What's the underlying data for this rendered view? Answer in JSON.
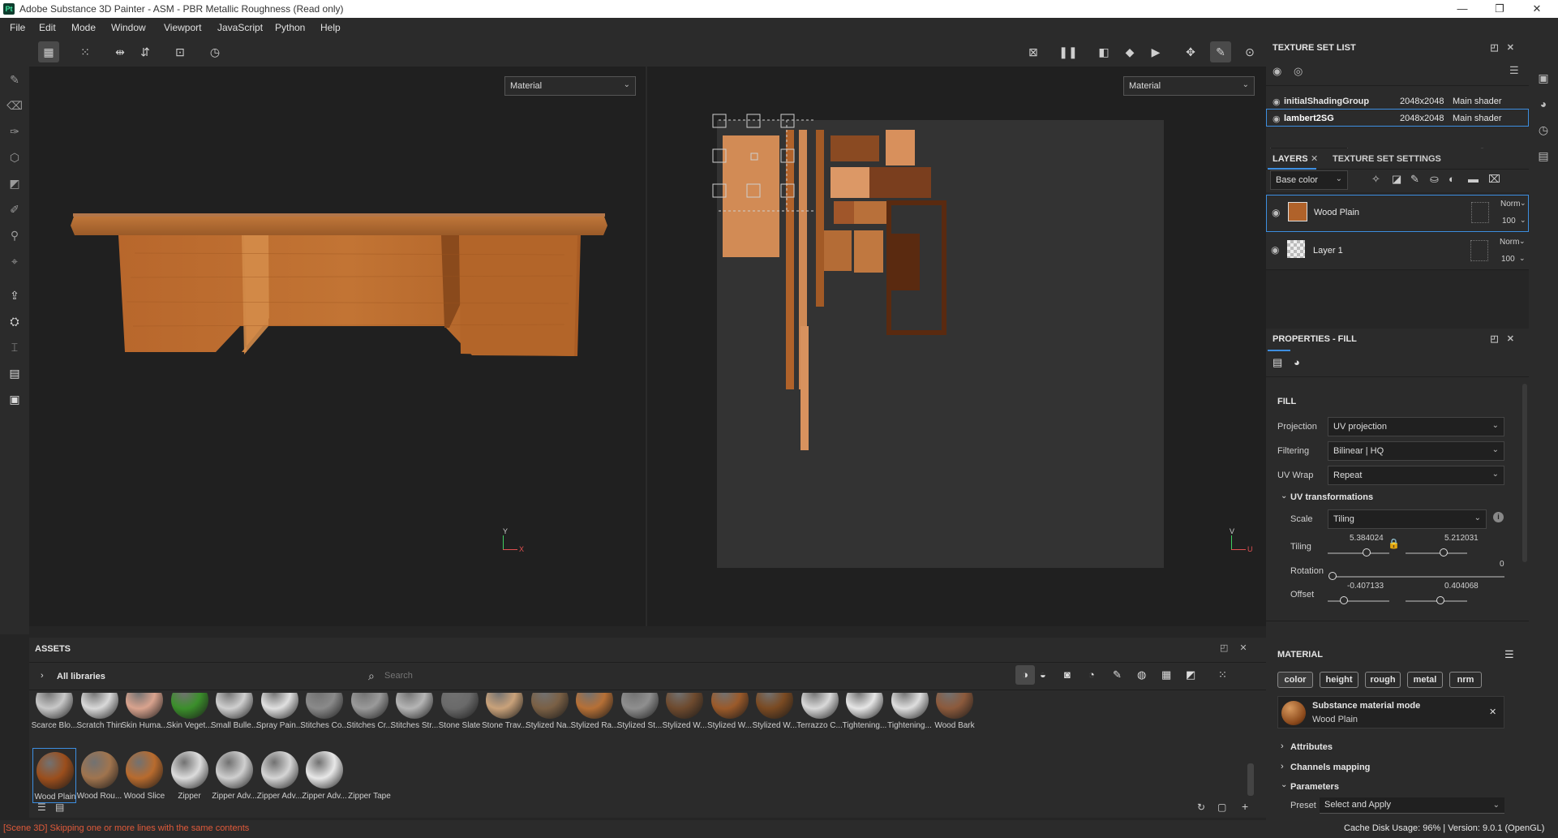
{
  "app": {
    "title": "Adobe Substance 3D Painter - ASM - PBR Metallic Roughness (Read only)",
    "icon_text": "Pt",
    "window_controls": [
      "—",
      "❐",
      "✕"
    ]
  },
  "menu": [
    "File",
    "Edit",
    "Mode",
    "Window",
    "Viewport",
    "JavaScript",
    "Python",
    "Help"
  ],
  "viewport_3d": {
    "channel": "Material",
    "axis_y": "Y",
    "axis_x": "X"
  },
  "viewport_2d": {
    "channel": "Material",
    "axis_v": "V",
    "axis_u": "U"
  },
  "texture_set_list": {
    "header": "TEXTURE SET LIST",
    "rows": [
      {
        "name": "initialShadingGroup",
        "resolution": "2048x2048",
        "shader": "Main shader"
      },
      {
        "name": "lambert2SG",
        "resolution": "2048x2048",
        "shader": "Main shader"
      }
    ]
  },
  "layers": {
    "tab_layers": "LAYERS",
    "tab_settings": "TEXTURE SET SETTINGS",
    "channel": "Base color",
    "items": [
      {
        "name": "Wood Plain",
        "blend": "Norm",
        "opacity": "100"
      },
      {
        "name": "Layer 1",
        "blend": "Norm",
        "opacity": "100"
      }
    ]
  },
  "properties": {
    "header": "PROPERTIES - FILL",
    "fill_title": "FILL",
    "projection_label": "Projection",
    "projection_value": "UV projection",
    "filtering_label": "Filtering",
    "filtering_value": "Bilinear | HQ",
    "uvwrap_label": "UV Wrap",
    "uvwrap_value": "Repeat",
    "uv_transformations": "UV transformations",
    "scale_label": "Scale",
    "scale_value": "Tiling",
    "tiling_label": "Tiling",
    "tiling_u": "5.384024",
    "tiling_v": "5.212031",
    "rotation_label": "Rotation",
    "rotation_value": "0",
    "offset_label": "Offset",
    "offset_u": "-0.407133",
    "offset_v": "0.404068",
    "material_title": "MATERIAL",
    "channels": [
      "color",
      "height",
      "rough",
      "metal",
      "nrm"
    ],
    "substance_mode": "Substance material mode",
    "substance_name": "Wood Plain",
    "attributes": "Attributes",
    "channels_mapping": "Channels mapping",
    "parameters": "Parameters",
    "preset_label": "Preset",
    "preset_value": "Select and Apply"
  },
  "assets": {
    "header": "ASSETS",
    "library": "All libraries",
    "search_placeholder": "Search",
    "row1": [
      "Scarce Blo...",
      "Scratch Thin",
      "Skin Huma...",
      "Skin Veget...",
      "Small Bulle...",
      "Spray Pain...",
      "Stitches Co...",
      "Stitches Cr...",
      "Stitches Str...",
      "Stone Slate",
      "Stone Trav...",
      "Stylized Na...",
      "Stylized Ra...",
      "Stylized St...",
      "Stylized W...",
      "Stylized W...",
      "Stylized W...",
      "Terrazzo C...",
      "Tightening...",
      "Tightening...",
      "Wood Bark"
    ],
    "row2": [
      "Wood Plain",
      "Wood Rou...",
      "Wood Slice",
      "Zipper",
      "Zipper Adv...",
      "Zipper Adv...",
      "Zipper Adv...",
      "Zipper Tape"
    ]
  },
  "status": {
    "message": "[Scene 3D] Skipping one or more lines with the same contents",
    "right": "Cache Disk Usage:   96% | Version: 9.0.1 (OpenGL)"
  },
  "colors": {
    "accent": "#3d8ee0",
    "wood": "#b0622a",
    "error": "#e05a3a"
  }
}
